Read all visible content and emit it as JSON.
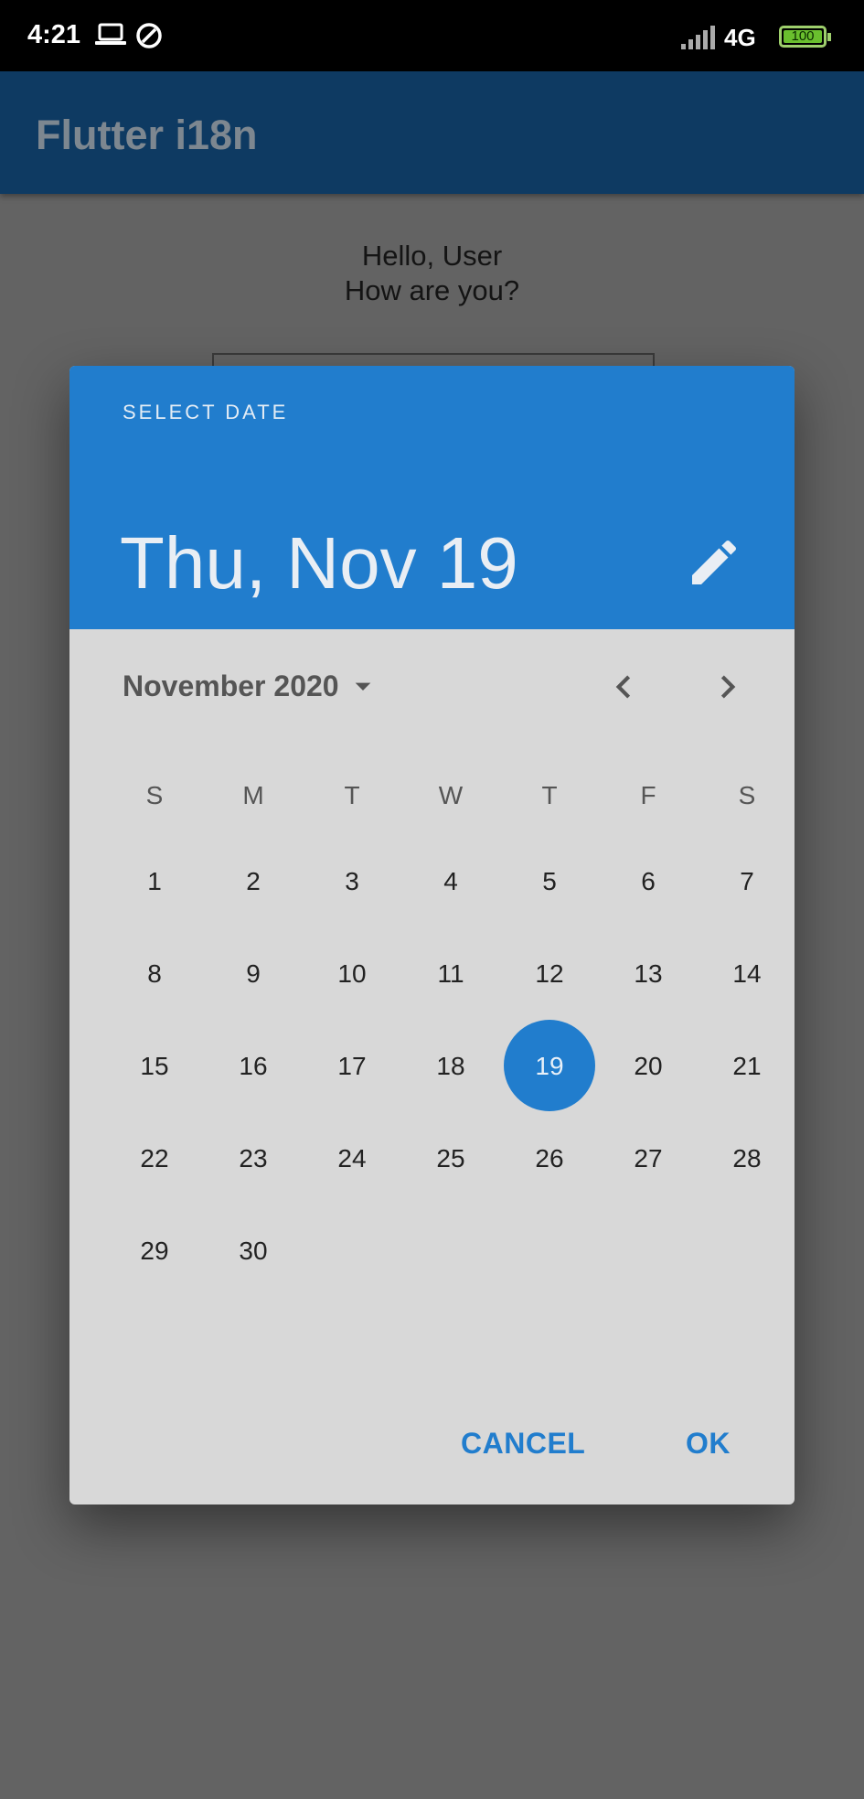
{
  "status_bar": {
    "time": "4:21",
    "network": "4G",
    "battery": "100",
    "icons": [
      "laptop-icon",
      "data-saver-icon",
      "signal-icon",
      "battery-icon"
    ]
  },
  "app_bar": {
    "title": "Flutter i18n"
  },
  "greeting": {
    "line1": "Hello, User",
    "line2": "How are you?"
  },
  "date_picker": {
    "help_text": "SELECT DATE",
    "selected_date": "Thu, Nov 19",
    "month_year": "November 2020",
    "weekdays": [
      "S",
      "M",
      "T",
      "W",
      "T",
      "F",
      "S"
    ],
    "days": [
      "1",
      "2",
      "3",
      "4",
      "5",
      "6",
      "7",
      "8",
      "9",
      "10",
      "11",
      "12",
      "13",
      "14",
      "15",
      "16",
      "17",
      "18",
      "19",
      "20",
      "21",
      "22",
      "23",
      "24",
      "25",
      "26",
      "27",
      "28",
      "29",
      "30"
    ],
    "selected_day": "19",
    "cancel_label": "CANCEL",
    "ok_label": "OK"
  },
  "colors": {
    "primary": "#217dcd",
    "app_bar_scrim": "#0e3a62",
    "dialog_surface": "#d8d8d8",
    "battery_fill": "#6abf2e"
  }
}
